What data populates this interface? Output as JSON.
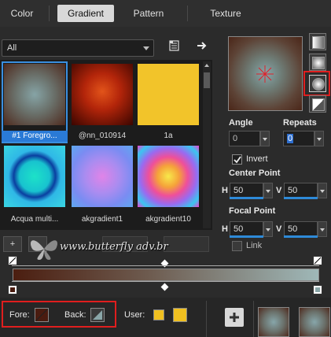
{
  "tabs": [
    {
      "label": "Color"
    },
    {
      "label": "Gradient"
    },
    {
      "label": "Pattern"
    },
    {
      "label": "Texture"
    }
  ],
  "category": {
    "value": "All"
  },
  "gallery": [
    {
      "caption": "#1 Foregro...",
      "selected": true
    },
    {
      "caption": "@nn_010914"
    },
    {
      "caption": "1a"
    },
    {
      "caption": "Acqua multi..."
    },
    {
      "caption": "akgradient1"
    },
    {
      "caption": "akgradient10"
    }
  ],
  "angle": {
    "label": "Angle",
    "value": "0"
  },
  "repeats": {
    "label": "Repeats",
    "value": "0"
  },
  "invert": {
    "label": "Invert",
    "checked": true
  },
  "center_point": {
    "label": "Center Point",
    "h_label": "H",
    "h_value": "50",
    "v_label": "V",
    "v_value": "50"
  },
  "focal_point": {
    "label": "Focal Point",
    "h_label": "H",
    "h_value": "50",
    "v_label": "V",
    "v_value": "50"
  },
  "link": {
    "label": "Link"
  },
  "watermark": {
    "text": "www.butterfly adv.br"
  },
  "bottom": {
    "fore_label": "Fore:",
    "back_label": "Back:",
    "user_label": "User:",
    "colors": {
      "fore": "#4a1c10",
      "back": "#8aa6a8",
      "user1": "#f0c020",
      "user2": "#f0c020"
    }
  }
}
